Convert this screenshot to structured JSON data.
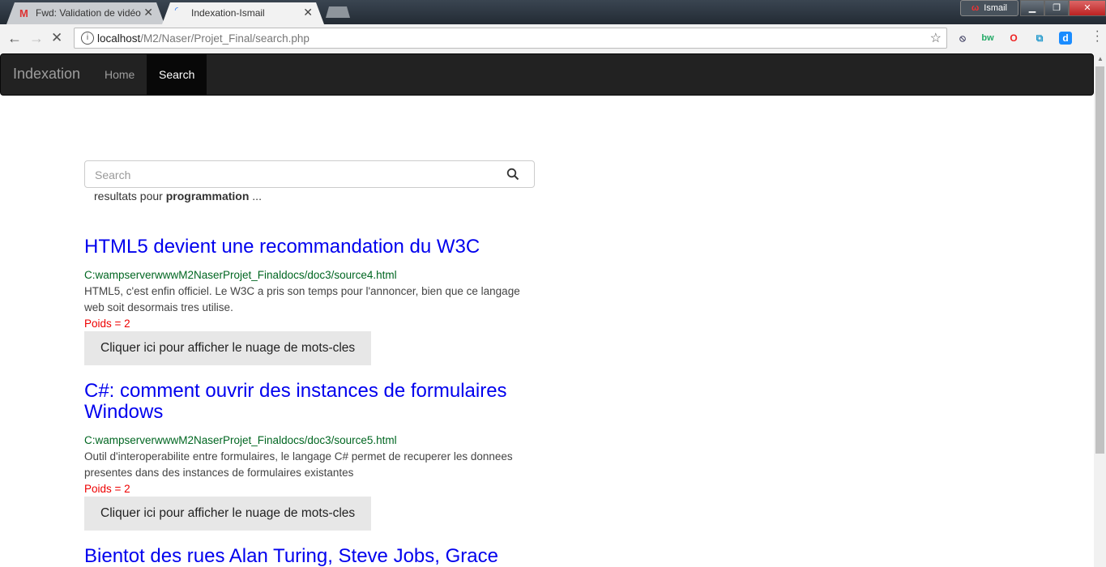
{
  "browser": {
    "tabs": [
      {
        "title": "Fwd: Validation de vidéo",
        "favicon": "gmail-icon"
      },
      {
        "title": "Indexation-Ismail",
        "favicon": "loading-icon"
      }
    ],
    "user_name": "Ismail",
    "url_host": "localhost",
    "url_path": "/M2/Naser/Projet_Final/search.php"
  },
  "navbar": {
    "brand": "Indexation",
    "items": [
      {
        "label": "Home"
      },
      {
        "label": "Search"
      }
    ]
  },
  "search": {
    "placeholder": "Search",
    "results_prefix": "resultats pour ",
    "query": "programmation",
    "results_suffix": " ..."
  },
  "results": [
    {
      "title": "HTML5 devient une recommandation du W3C",
      "path": "C:wampserverwwwM2NaserProjet_Finaldocs/doc3/source4.html",
      "desc": "HTML5, c'est enfin officiel. Le W3C a pris son temps pour l'annoncer, bien que ce langage web soit desormais tres utilise.",
      "poids": "Poids = 2",
      "button": "Cliquer ici pour afficher le nuage de mots-cles"
    },
    {
      "title": "C#: comment ouvrir des instances de formulaires Windows",
      "path": "C:wampserverwwwM2NaserProjet_Finaldocs/doc3/source5.html",
      "desc": "Outil d'interoperabilite entre formulaires, le langage C# permet de recuperer les donnees presentes dans des instances de formulaires existantes",
      "poids": "Poids = 2",
      "button": "Cliquer ici pour afficher le nuage de mots-cles"
    },
    {
      "title": "Bientot des rues Alan Turing, Steve Jobs, Grace"
    }
  ]
}
